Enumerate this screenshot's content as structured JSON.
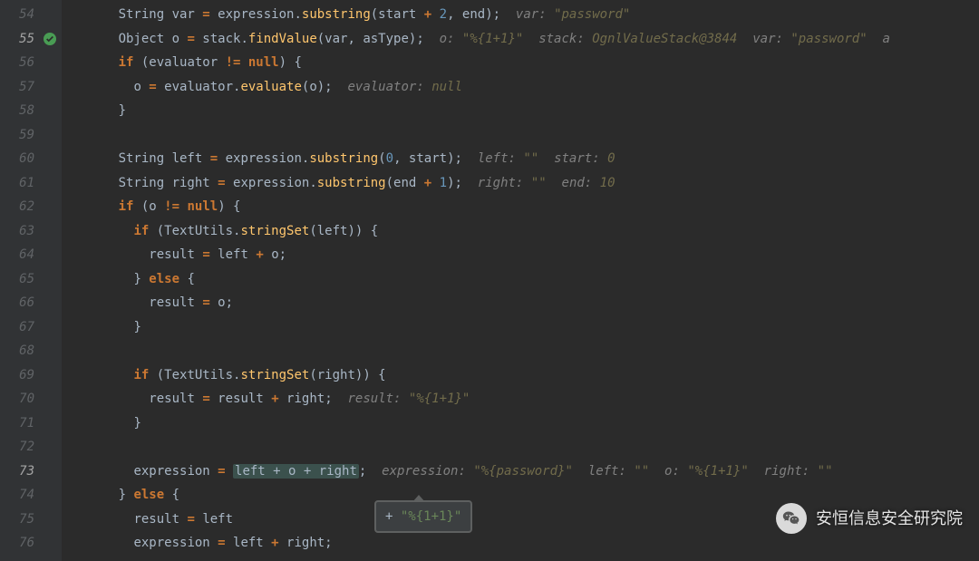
{
  "lines": {
    "start": 54,
    "highlight": [
      55,
      73
    ]
  },
  "breakpoint_line": 55,
  "exec_line": 73,
  "code": {
    "l54": {
      "indent": "      ",
      "tokens": [
        [
          "id",
          "String var "
        ],
        [
          "kw",
          "= "
        ],
        [
          "id",
          "expression"
        ],
        [
          "id",
          "."
        ],
        [
          "fn",
          "substring"
        ],
        [
          "id",
          "(start "
        ],
        [
          "kw",
          "+ "
        ],
        [
          "num",
          "2"
        ],
        [
          "id",
          ", end);  "
        ],
        [
          "com",
          "var: "
        ],
        [
          "comv",
          "\"password\""
        ]
      ]
    },
    "l55": {
      "indent": "      ",
      "tokens": [
        [
          "id",
          "Object o "
        ],
        [
          "kw",
          "= "
        ],
        [
          "id",
          "stack"
        ],
        [
          "id",
          "."
        ],
        [
          "fn",
          "findValue"
        ],
        [
          "id",
          "(var, asType);  "
        ],
        [
          "com",
          "o: "
        ],
        [
          "comv",
          "\"%{1+1}\""
        ],
        [
          "com",
          "  stack: "
        ],
        [
          "comv",
          "OgnlValueStack@3844"
        ],
        [
          "com",
          "  var: "
        ],
        [
          "comv",
          "\"password\""
        ],
        [
          "com",
          "  a"
        ]
      ]
    },
    "l56": {
      "indent": "      ",
      "tokens": [
        [
          "kw",
          "if "
        ],
        [
          "id",
          "(evaluator "
        ],
        [
          "kw",
          "!= null"
        ],
        [
          "id",
          ") {"
        ]
      ]
    },
    "l57": {
      "indent": "        ",
      "tokens": [
        [
          "id",
          "o "
        ],
        [
          "kw",
          "= "
        ],
        [
          "id",
          "evaluator"
        ],
        [
          "id",
          "."
        ],
        [
          "fn",
          "evaluate"
        ],
        [
          "id",
          "(o);  "
        ],
        [
          "com",
          "evaluator: "
        ],
        [
          "comv",
          "null"
        ]
      ]
    },
    "l58": {
      "indent": "      ",
      "tokens": [
        [
          "id",
          "}"
        ]
      ]
    },
    "l59": {
      "indent": "",
      "tokens": []
    },
    "l60": {
      "indent": "      ",
      "tokens": [
        [
          "id",
          "String left "
        ],
        [
          "kw",
          "= "
        ],
        [
          "id",
          "expression"
        ],
        [
          "id",
          "."
        ],
        [
          "fn",
          "substring"
        ],
        [
          "id",
          "("
        ],
        [
          "num",
          "0"
        ],
        [
          "id",
          ", start);  "
        ],
        [
          "com",
          "left: "
        ],
        [
          "comv",
          "\"\""
        ],
        [
          "com",
          "  start: "
        ],
        [
          "comv",
          "0"
        ]
      ]
    },
    "l61": {
      "indent": "      ",
      "tokens": [
        [
          "id",
          "String right "
        ],
        [
          "kw",
          "= "
        ],
        [
          "id",
          "expression"
        ],
        [
          "id",
          "."
        ],
        [
          "fn",
          "substring"
        ],
        [
          "id",
          "(end "
        ],
        [
          "kw",
          "+ "
        ],
        [
          "num",
          "1"
        ],
        [
          "id",
          ");  "
        ],
        [
          "com",
          "right: "
        ],
        [
          "comv",
          "\"\""
        ],
        [
          "com",
          "  end: "
        ],
        [
          "comv",
          "10"
        ]
      ]
    },
    "l62": {
      "indent": "      ",
      "tokens": [
        [
          "kw",
          "if "
        ],
        [
          "id",
          "(o "
        ],
        [
          "kw",
          "!= null"
        ],
        [
          "id",
          ") {"
        ]
      ]
    },
    "l63": {
      "indent": "        ",
      "tokens": [
        [
          "kw",
          "if "
        ],
        [
          "id",
          "(TextUtils"
        ],
        [
          "id",
          "."
        ],
        [
          "fn",
          "stringSet"
        ],
        [
          "id",
          "(left)) {"
        ]
      ]
    },
    "l64": {
      "indent": "          ",
      "tokens": [
        [
          "id",
          "result "
        ],
        [
          "kw",
          "= "
        ],
        [
          "id",
          "left "
        ],
        [
          "kw",
          "+ "
        ],
        [
          "id",
          "o;"
        ]
      ]
    },
    "l65": {
      "indent": "        ",
      "tokens": [
        [
          "id",
          "} "
        ],
        [
          "kw",
          "else "
        ],
        [
          "id",
          "{"
        ]
      ]
    },
    "l66": {
      "indent": "          ",
      "tokens": [
        [
          "id",
          "result "
        ],
        [
          "kw",
          "= "
        ],
        [
          "id",
          "o;"
        ]
      ]
    },
    "l67": {
      "indent": "        ",
      "tokens": [
        [
          "id",
          "}"
        ]
      ]
    },
    "l68": {
      "indent": "",
      "tokens": []
    },
    "l69": {
      "indent": "        ",
      "tokens": [
        [
          "kw",
          "if "
        ],
        [
          "id",
          "(TextUtils"
        ],
        [
          "id",
          "."
        ],
        [
          "fn",
          "stringSet"
        ],
        [
          "id",
          "(right)) {"
        ]
      ]
    },
    "l70": {
      "indent": "          ",
      "tokens": [
        [
          "id",
          "result "
        ],
        [
          "kw",
          "= "
        ],
        [
          "id",
          "result "
        ],
        [
          "kw",
          "+ "
        ],
        [
          "id",
          "right;  "
        ],
        [
          "com",
          "result: "
        ],
        [
          "comv",
          "\"%{1+1}\""
        ]
      ]
    },
    "l71": {
      "indent": "        ",
      "tokens": [
        [
          "id",
          "}"
        ]
      ]
    },
    "l72": {
      "indent": "",
      "tokens": []
    },
    "l73": {
      "indent": "        ",
      "tokens": [
        [
          "id",
          "expression "
        ],
        [
          "kw",
          "= "
        ],
        [
          "hl",
          "left + o + right"
        ],
        [
          "id",
          ";  "
        ],
        [
          "com",
          "expression: "
        ],
        [
          "comv",
          "\"%{password}\""
        ],
        [
          "com",
          "  left: "
        ],
        [
          "comv",
          "\"\""
        ],
        [
          "com",
          "  o: "
        ],
        [
          "comv",
          "\"%{1+1}\""
        ],
        [
          "com",
          "  right: "
        ],
        [
          "comv",
          "\"\""
        ]
      ]
    },
    "l74": {
      "indent": "      ",
      "tokens": [
        [
          "id",
          "} "
        ],
        [
          "kw",
          "else "
        ],
        [
          "id",
          "{"
        ]
      ]
    },
    "l75": {
      "indent": "        ",
      "tokens": [
        [
          "id",
          "result "
        ],
        [
          "kw",
          "= "
        ],
        [
          "id",
          "left"
        ]
      ]
    },
    "l76": {
      "indent": "        ",
      "tokens": [
        [
          "id",
          "expression "
        ],
        [
          "kw",
          "= "
        ],
        [
          "id",
          "left "
        ],
        [
          "kw",
          "+ "
        ],
        [
          "id",
          "right;"
        ]
      ]
    }
  },
  "tooltip": {
    "prefix": "+ ",
    "value": "\"%{1+1}\""
  },
  "watermark": "安恒信息安全研究院"
}
